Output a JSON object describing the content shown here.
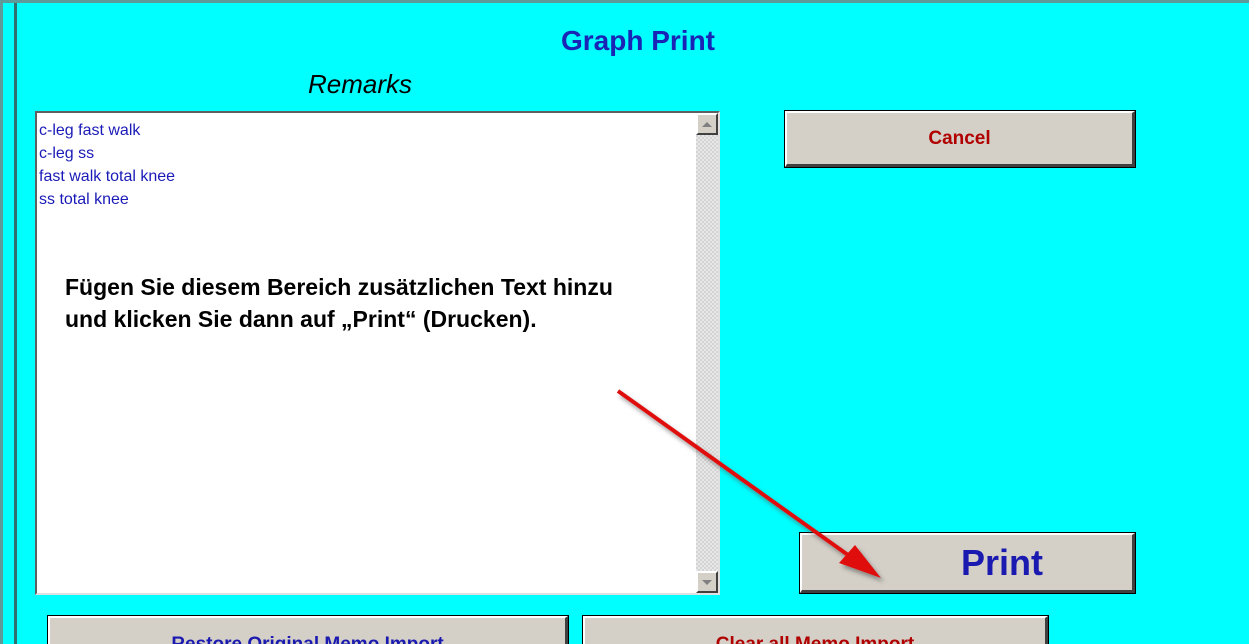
{
  "window": {
    "title": "Graph Print"
  },
  "remarks": {
    "label": "Remarks",
    "lines": [
      "c-leg fast walk",
      "c-leg ss",
      "fast walk total knee",
      "ss total knee"
    ]
  },
  "annotation": {
    "line1": "Fügen Sie diesem Bereich zusätzlichen Text hinzu",
    "line2": "und klicken Sie dann auf „Print“ (Drucken).",
    "arrow_color": "#e01010"
  },
  "buttons": {
    "cancel_label": "Cancel",
    "print_label": "Print",
    "restore_label": "Restore Original Memo Import",
    "clear_label": "Clear all Memo Import"
  },
  "colors": {
    "background": "#00ffff",
    "title": "#1a24b5",
    "cancel_text": "#b00000",
    "print_text": "#1a1ab0"
  },
  "icons": {
    "scroll_up": "scroll-up-arrow-icon",
    "scroll_down": "scroll-down-arrow-icon"
  }
}
